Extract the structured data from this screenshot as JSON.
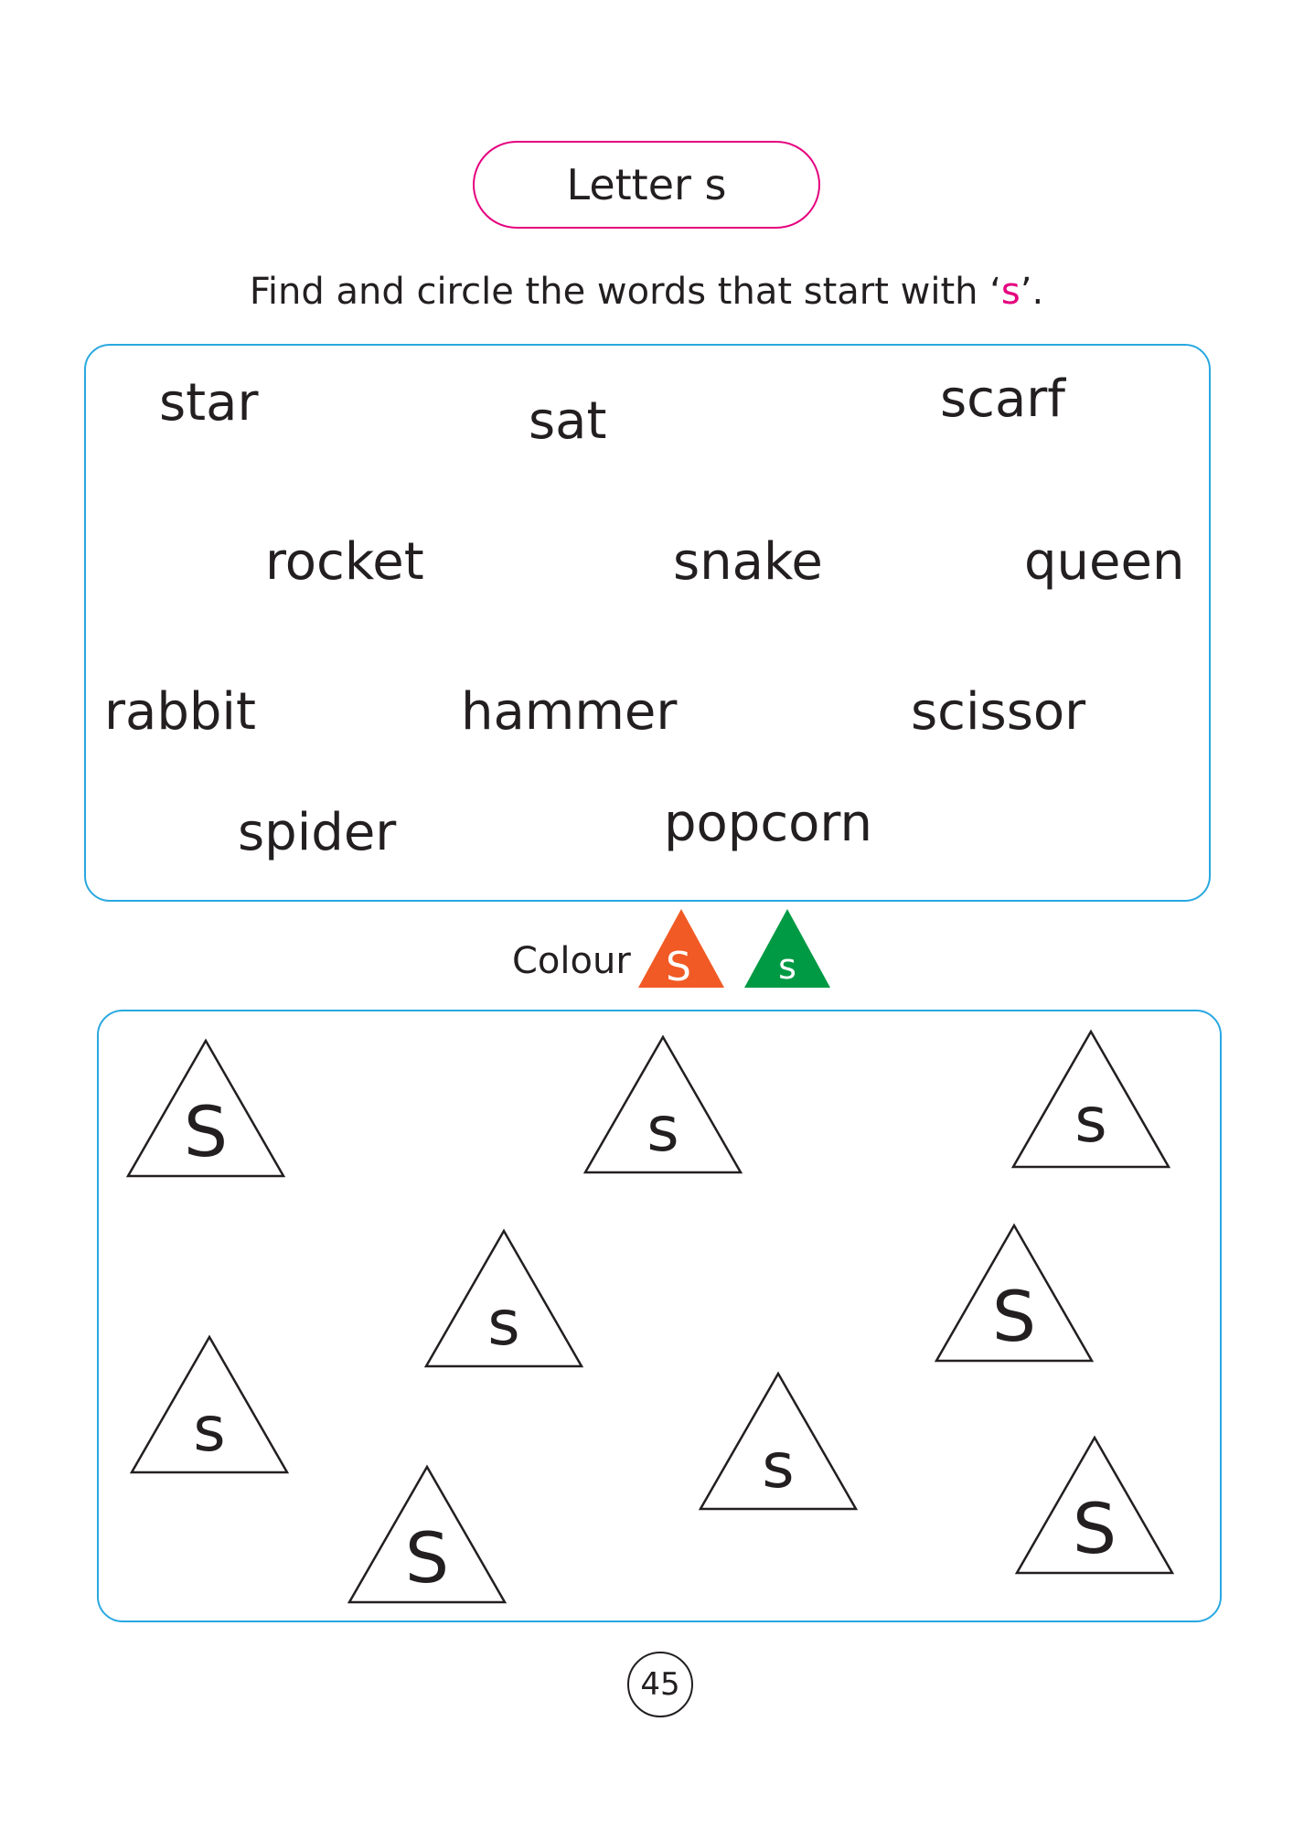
{
  "title": "Letter s",
  "instruction": {
    "before": "Find and circle the words that start with ‘",
    "letter": "s",
    "after": "’."
  },
  "words": [
    "star",
    "sat",
    "scarf",
    "rocket",
    "snake",
    "queen",
    "rabbit",
    "hammer",
    "scissor",
    "spider",
    "popcorn"
  ],
  "colour": {
    "label": "Colour",
    "swatches": [
      {
        "letter": "S",
        "color": "#f15a24"
      },
      {
        "letter": "s",
        "color": "#009a44"
      }
    ]
  },
  "triangles": [
    "S",
    "s",
    "s",
    "s",
    "S",
    "s",
    "s",
    "S",
    "S"
  ],
  "page_number": "45"
}
